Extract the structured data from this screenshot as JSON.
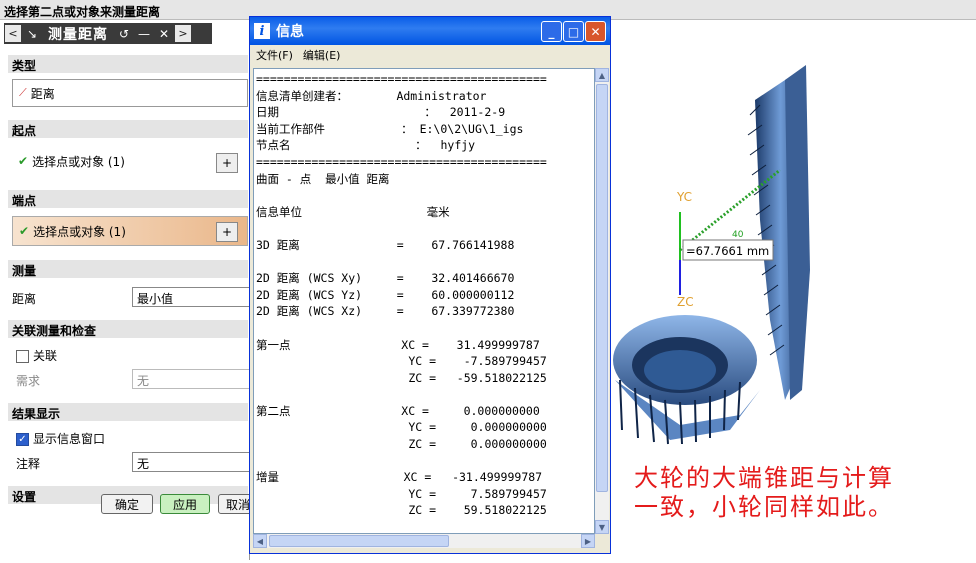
{
  "topbar": {
    "title": "选择第二点或对象来测量距离"
  },
  "toolrow": {
    "title": "测量距离",
    "back": "<",
    "fwd": ">",
    "undo": "↺",
    "min": "—",
    "close": "✕"
  },
  "panel": {
    "type_section": "类型",
    "type_value": "距离",
    "start_section": "起点",
    "start_select": "选择点或对象 (1)",
    "end_section": "端点",
    "end_select": "选择点或对象 (1)",
    "measure_section": "测量",
    "distance_label": "距离",
    "distance_value": "最小值",
    "assoc_section": "关联测量和检查",
    "assoc_label": "关联",
    "require_label": "需求",
    "require_value": "无",
    "result_section": "结果显示",
    "show_info_label": "显示信息窗口",
    "note_label": "注释",
    "note_value": "无",
    "settings_section": "设置",
    "ok": "确定",
    "apply": "应用",
    "cancel": "取消"
  },
  "dialog": {
    "title": "信息",
    "menu_file": "文件(F)",
    "menu_edit": "编辑(E)",
    "lines": [
      "==========================================",
      "信息清单创建者：       Administrator",
      "日期                     ：  2011-2-9",
      "当前工作部件           ： E:\\0\\2\\UG\\1_igs",
      "节点名                  ：  hyfjy",
      "==========================================",
      "曲面 - 点  最小值 距离",
      "",
      "信息单位                  毫米",
      "",
      "3D 距离              =    67.766141988",
      "",
      "2D 距离 (WCS Xy)     =    32.401466670",
      "2D 距离 (WCS Yz)     =    60.000000112",
      "2D 距离 (WCS Xz)     =    67.339772380",
      "",
      "第一点                XC =    31.499999787",
      "                      YC =    -7.589799457",
      "                      ZC =   -59.518022125",
      "",
      "第二点                XC =     0.000000000",
      "                      YC =     0.000000000",
      "                      ZC =     0.000000000",
      "",
      "增量                  XC =   -31.499999787",
      "                      YC =     7.589799457",
      "                      ZC =    59.518022125"
    ]
  },
  "viewport": {
    "yc": "YC",
    "zc": "ZC",
    "measure": "=67.7661 mm",
    "tick": "40"
  },
  "annotation": {
    "line1": "大轮的大端锥距与计算",
    "line2": "一致，小轮同样如此。"
  }
}
